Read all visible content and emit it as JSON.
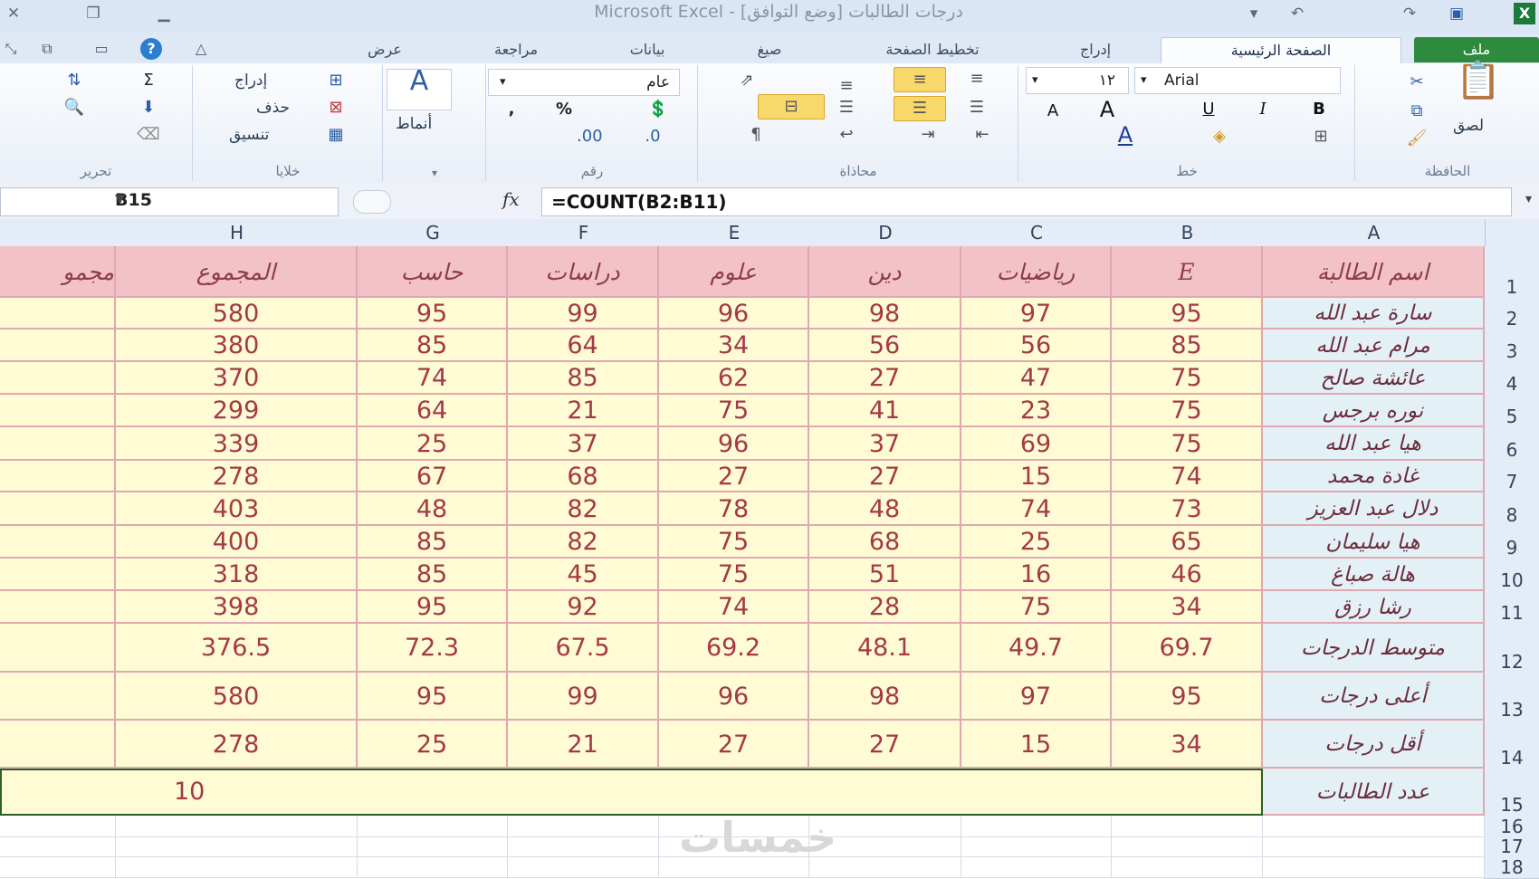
{
  "window": {
    "title": "Microsoft Excel - [وضع التوافق]  درجات الطالبات"
  },
  "tabs": [
    "ملف",
    "الصفحة الرئيسية",
    "إدراج",
    "تخطيط الصفحة",
    "صيغ",
    "بيانات",
    "مراجعة",
    "عرض"
  ],
  "ribbon": {
    "clipboard": {
      "label": "الحافظة",
      "paste": "لصق"
    },
    "font": {
      "label": "خط",
      "name": "Arial",
      "size": "١٢"
    },
    "alignment": {
      "label": "محاذاة"
    },
    "number": {
      "label": "رقم",
      "format": "عام"
    },
    "styles": {
      "label": "أنماط"
    },
    "cells": {
      "label": "خلايا",
      "insert": "إدراج",
      "delete": "حذف",
      "format": "تنسيق"
    },
    "editing": {
      "label": "تحرير"
    }
  },
  "formula_bar": {
    "name_box": "B15",
    "fx": "fx",
    "formula": "=COUNT(B2:B11)"
  },
  "columns": [
    "A",
    "B",
    "C",
    "D",
    "E",
    "F",
    "G",
    "H"
  ],
  "header_row": [
    "اسم الطالبة",
    "E",
    "رياضيات",
    "دين",
    "علوم",
    "دراسات",
    "حاسب",
    "المجموع"
  ],
  "truncated_header": "مجمو",
  "students": [
    {
      "name": "سارة عبد الله",
      "scores": [
        "95",
        "97",
        "98",
        "96",
        "99",
        "95",
        "580"
      ]
    },
    {
      "name": "مرام عبد الله",
      "scores": [
        "85",
        "56",
        "56",
        "34",
        "64",
        "85",
        "380"
      ]
    },
    {
      "name": "عائشة صالح",
      "scores": [
        "75",
        "47",
        "27",
        "62",
        "85",
        "74",
        "370"
      ]
    },
    {
      "name": "نوره برجس",
      "scores": [
        "75",
        "23",
        "41",
        "75",
        "21",
        "64",
        "299"
      ]
    },
    {
      "name": "هيا عبد الله",
      "scores": [
        "75",
        "69",
        "37",
        "96",
        "37",
        "25",
        "339"
      ]
    },
    {
      "name": "غادة محمد",
      "scores": [
        "74",
        "15",
        "27",
        "27",
        "68",
        "67",
        "278"
      ]
    },
    {
      "name": "دلال عبد العزيز",
      "scores": [
        "73",
        "74",
        "48",
        "78",
        "82",
        "48",
        "403"
      ]
    },
    {
      "name": "هيا سليمان",
      "scores": [
        "65",
        "25",
        "68",
        "75",
        "82",
        "85",
        "400"
      ]
    },
    {
      "name": "هالة صباغ",
      "scores": [
        "46",
        "16",
        "51",
        "75",
        "45",
        "85",
        "318"
      ]
    },
    {
      "name": "رشا رزق",
      "scores": [
        "34",
        "75",
        "28",
        "74",
        "92",
        "95",
        "398"
      ]
    }
  ],
  "summary": [
    {
      "label": "متوسط الدرجات",
      "values": [
        "69.7",
        "49.7",
        "48.1",
        "69.2",
        "67.5",
        "72.3",
        "376.5"
      ]
    },
    {
      "label": "أعلى درجات",
      "values": [
        "95",
        "97",
        "98",
        "96",
        "99",
        "95",
        "580"
      ]
    },
    {
      "label": "أقل درجات",
      "values": [
        "34",
        "15",
        "27",
        "27",
        "21",
        "25",
        "278"
      ]
    }
  ],
  "count_row": {
    "label": "عدد الطالبات",
    "value": "10"
  },
  "row_numbers": [
    "1",
    "2",
    "3",
    "4",
    "5",
    "6",
    "7",
    "8",
    "9",
    "10",
    "11",
    "12",
    "13",
    "14",
    "15",
    "16",
    "17",
    "18"
  ],
  "watermark": "خمسات"
}
